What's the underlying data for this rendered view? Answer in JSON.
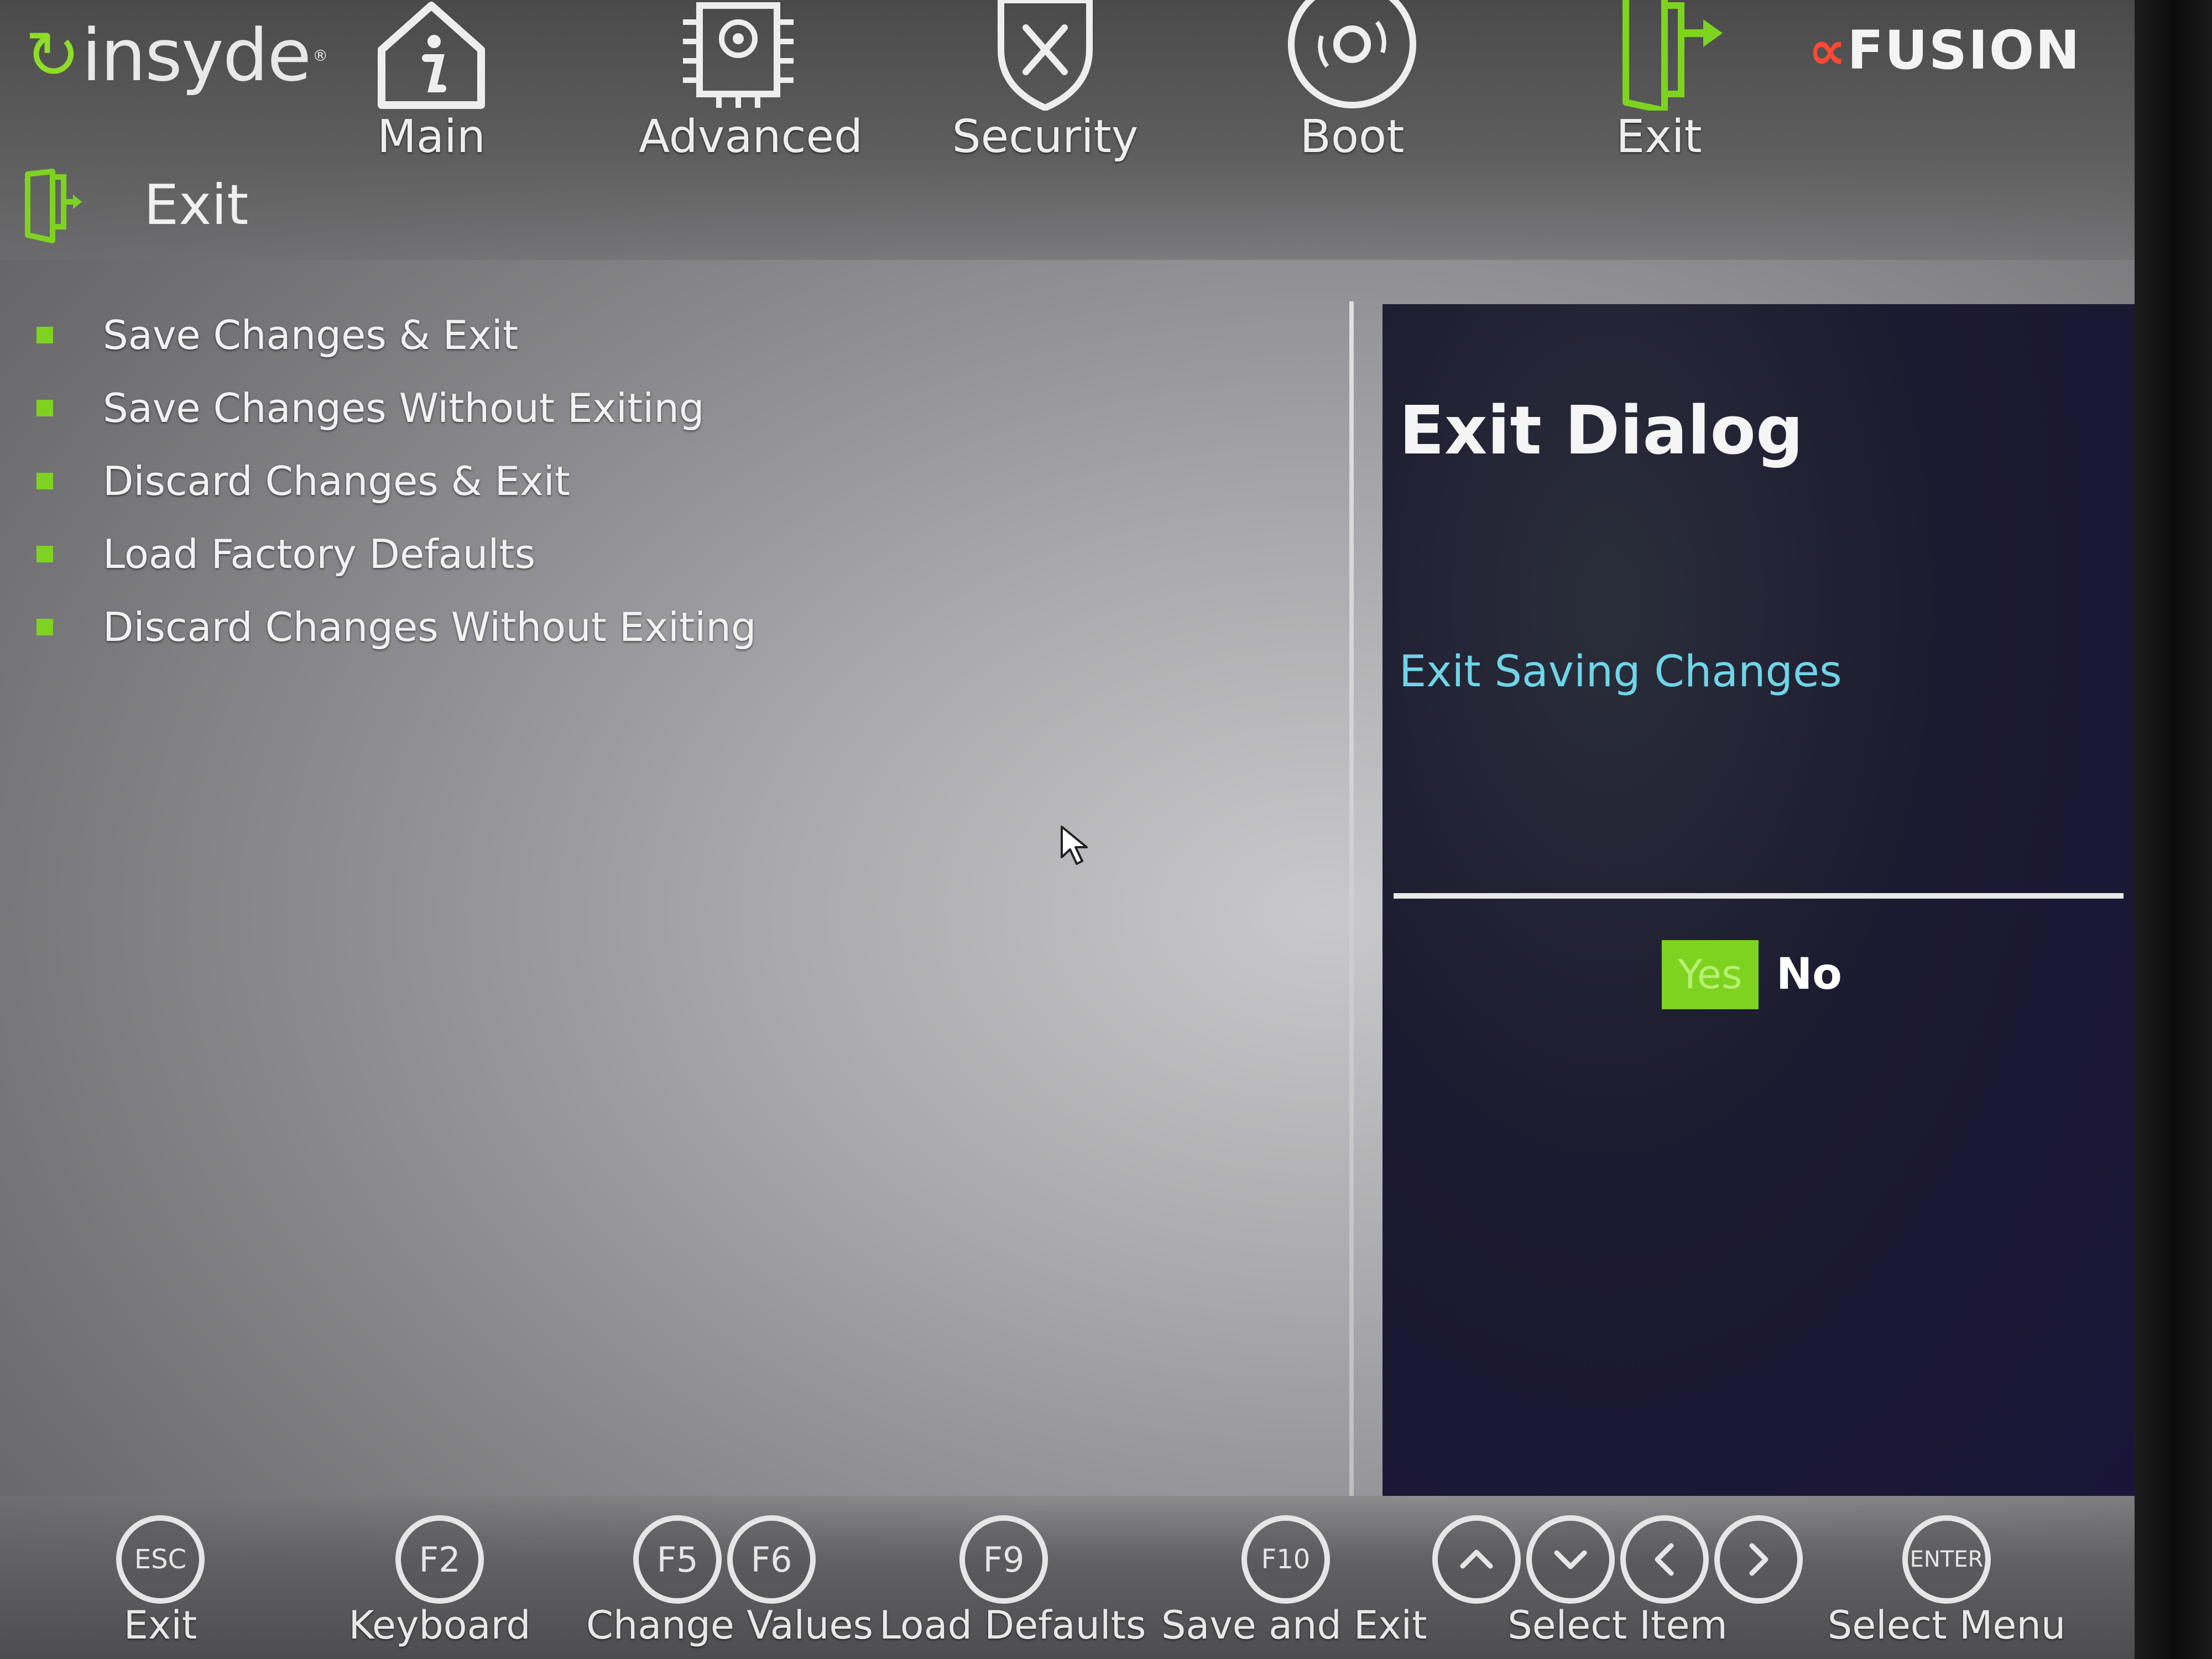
{
  "brand": {
    "logo_text": "insyde",
    "trademark": "®"
  },
  "vendor_logo": {
    "symbol": "∝",
    "text": "FUSION"
  },
  "nav": [
    {
      "label": "Main",
      "icon": "info-home-icon"
    },
    {
      "label": "Advanced",
      "icon": "chip-gear-icon"
    },
    {
      "label": "Security",
      "icon": "shield-tools-icon"
    },
    {
      "label": "Boot",
      "icon": "disc-icon"
    },
    {
      "label": "Exit",
      "icon": "door-exit-icon",
      "active": true
    }
  ],
  "section": {
    "title": "Exit",
    "icon": "door-exit-icon"
  },
  "menu": [
    "Save Changes & Exit",
    "Save Changes Without Exiting",
    "Discard Changes & Exit",
    "Load Factory Defaults",
    "Discard Changes Without Exiting"
  ],
  "dialog": {
    "title": "Exit Dialog",
    "message": "Exit Saving Changes",
    "yes_label": "Yes",
    "no_label": "No",
    "selected": "Yes"
  },
  "hotkeys": [
    {
      "keys": [
        "ESC"
      ],
      "label": "Exit"
    },
    {
      "keys": [
        "F2"
      ],
      "label": "Keyboard"
    },
    {
      "keys": [
        "F5",
        "F6"
      ],
      "label": "Change Values"
    },
    {
      "keys": [
        "F9"
      ],
      "label": "Load Defaults"
    },
    {
      "keys": [
        "F10"
      ],
      "label": "Save and Exit"
    },
    {
      "keys": [
        "up-arrow",
        "down-arrow",
        "left-arrow",
        "right-arrow"
      ],
      "label": "Select Item"
    },
    {
      "keys": [
        "ENTER"
      ],
      "label": "Select Menu"
    }
  ],
  "colors": {
    "accent_green": "#7ed321",
    "dialog_message": "#6fd4e6",
    "vendor_red": "#ff4a32",
    "dialog_bg": "#1c1a30"
  }
}
